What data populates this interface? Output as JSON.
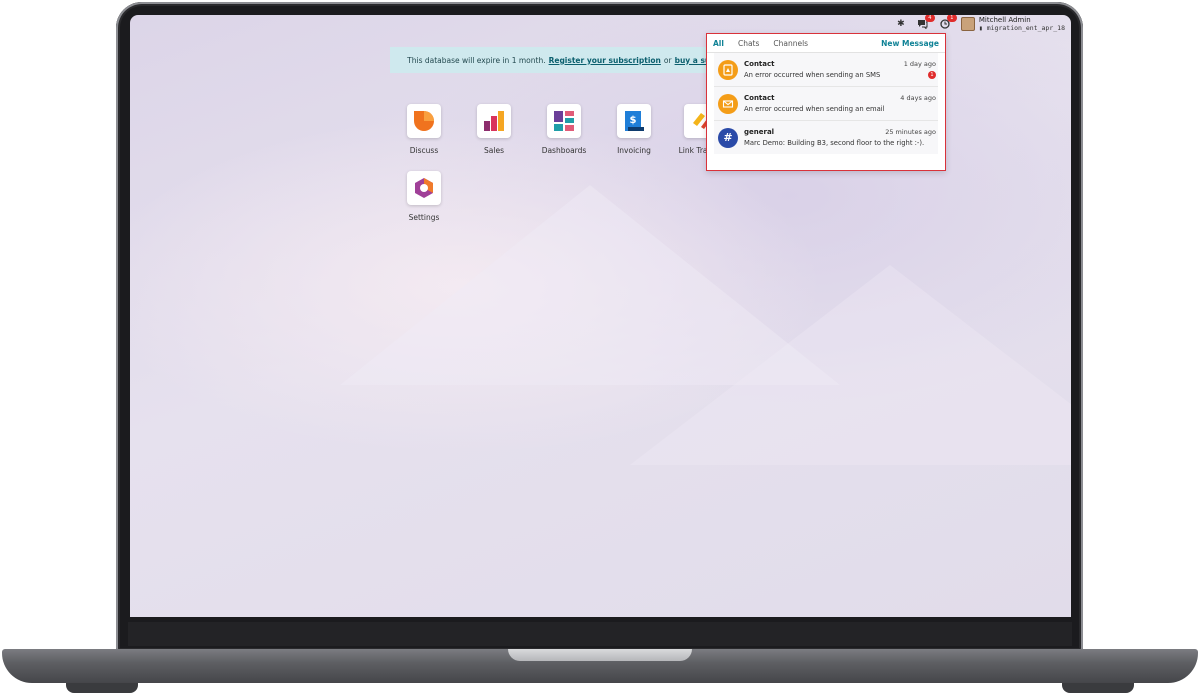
{
  "systray": {
    "chat_badge": "4",
    "activity_badge": "1",
    "user_name": "Mitchell Admin",
    "database": "migration_ent_apr_18"
  },
  "banner": {
    "text": "This database will expire in 1 month.",
    "register_link": "Register your subscription",
    "or_text": "or",
    "buy_link": "buy a subscription"
  },
  "apps": [
    {
      "label": "Discuss",
      "icon": "discuss-icon",
      "color": "#f0731e"
    },
    {
      "label": "Sales",
      "icon": "sales-icon",
      "color": "#c52b6d"
    },
    {
      "label": "Dashboards",
      "icon": "dashboards-icon",
      "color": "#e05c78"
    },
    {
      "label": "Invoicing",
      "icon": "invoicing-icon",
      "color": "#1f7ed8"
    },
    {
      "label": "Link Tracker",
      "icon": "link-tracker-icon",
      "color": "#f4b41a"
    },
    {
      "label": "Settings",
      "icon": "settings-icon",
      "color": "#a04098"
    }
  ],
  "messaging": {
    "tabs": [
      "All",
      "Chats",
      "Channels"
    ],
    "new_message": "New Message",
    "items": [
      {
        "title": "Contact",
        "time": "1 day ago",
        "text": "An error occurred when sending an SMS",
        "count": "1",
        "avatar_color": "#f49d18",
        "icon": "sms-error-icon"
      },
      {
        "title": "Contact",
        "time": "4 days ago",
        "text": "An error occurred when sending an email",
        "count": "",
        "avatar_color": "#f49d18",
        "icon": "email-error-icon"
      },
      {
        "title": "general",
        "time": "25 minutes ago",
        "text": "Marc Demo: Building B3, second floor to the right :-).",
        "count": "",
        "avatar_color": "#2a4aa8",
        "icon": "channel-hash-icon"
      }
    ]
  }
}
